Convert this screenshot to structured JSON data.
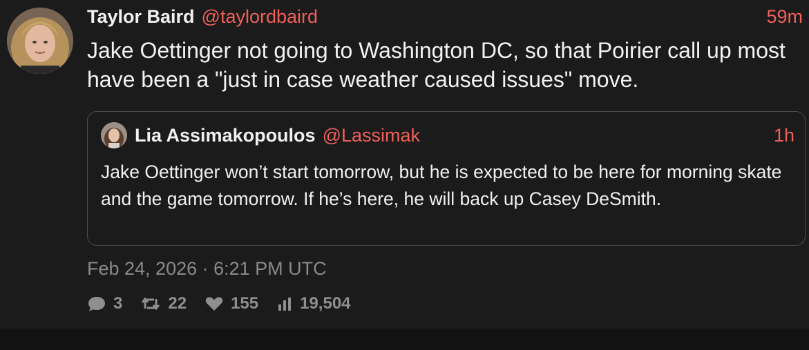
{
  "tweet": {
    "author_name": "Taylor Baird",
    "handle": "@taylordbaird",
    "time": "59m",
    "text": "Jake Oettinger not going to Washington DC, so that Poirier call up most have been a \"just in case weather caused issues\" move.",
    "timestamp": "Feb 24, 2026 · 6:21 PM UTC",
    "stats": {
      "replies": "3",
      "retweets": "22",
      "likes": "155",
      "views": "19,504"
    }
  },
  "quote": {
    "author_name": "Lia Assimakopoulos",
    "handle": "@Lassimak",
    "time": "1h",
    "text": "Jake Oettinger won’t start tomorrow, but he is expected to be here for morning skate and the game tomorrow. If he’s here, he will back up Casey DeSmith."
  },
  "icons": {
    "reply": "speech-bubble-icon",
    "retweet": "retweet-icon",
    "like": "heart-icon",
    "views": "bar-chart-icon"
  },
  "colors": {
    "accent": "#f0605a",
    "background": "#1b1b1b",
    "text": "#f2f2f2",
    "muted": "#8a8a8a"
  }
}
